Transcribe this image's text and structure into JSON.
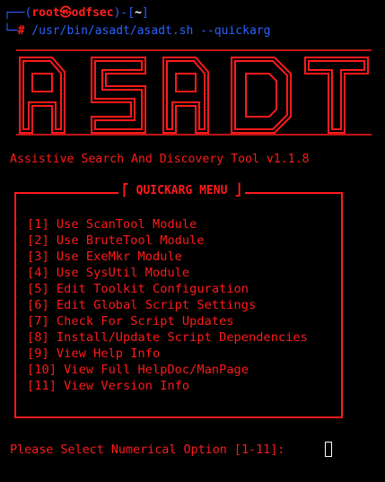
{
  "prompt": {
    "corner_open": "┌──(",
    "user_host": "root㉿odfsec",
    "corner_mid": ")-[",
    "cwd": "~",
    "corner_close": "]",
    "line2_corner": "└─",
    "hash": "#",
    "command": " /usr/bin/asadt/asadt.sh",
    "argument": " --quickarg"
  },
  "banner": {
    "logo_text": "ASADT",
    "color": "#ff1a1a"
  },
  "tagline": "Assistive Search And Discovery Tool v1.1.8",
  "menu": {
    "title": "⎡ QUICKARG MENU ⎦",
    "items": [
      "[1] Use ScanTool Module",
      "[2] Use BruteTool Module",
      "[3] Use ExeMkr Module",
      "[4] Use SysUtil Module",
      "[5] Edit Toolkit Configuration",
      "[6] Edit Global Script Settings",
      "[7] Check For Script Updates",
      "[8] Install/Update Script Dependencies",
      "[9] View Help Info",
      "[10] View Full HelpDoc/ManPage",
      "[11] View Version Info"
    ]
  },
  "input_prompt": "Please Select Numerical Option [1-11]: ",
  "colors": {
    "background": "#000000",
    "primary_red": "#ff1a1a",
    "prompt_blue": "#2b63ff",
    "cursor": "#ffffff"
  }
}
